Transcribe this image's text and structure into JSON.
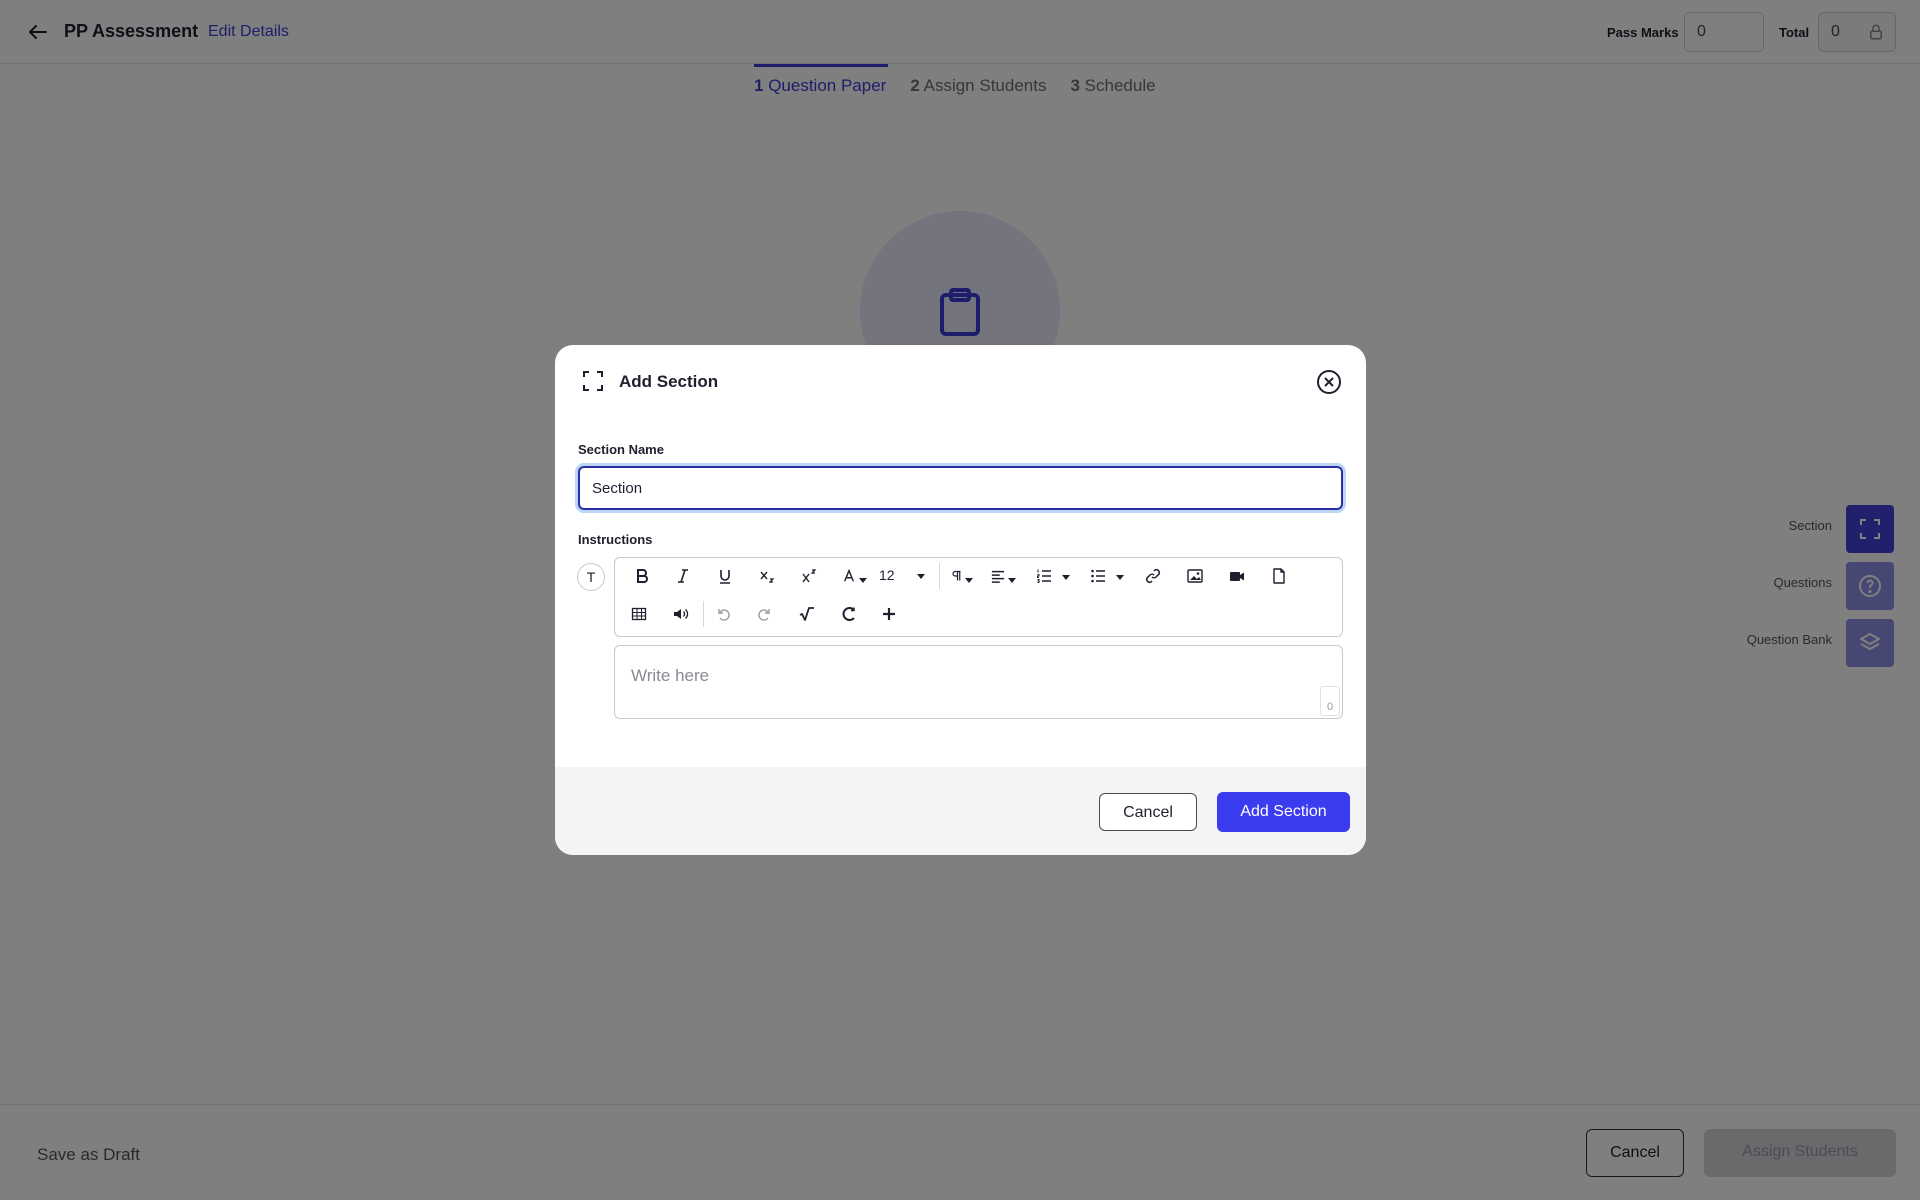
{
  "header": {
    "title": "PP Assessment",
    "edit_link": "Edit Details",
    "pass_marks_label": "Pass Marks",
    "pass_marks_value": "0",
    "total_label": "Total",
    "total_value": "0"
  },
  "steps": [
    {
      "num": "1",
      "label": "Question Paper",
      "active": true
    },
    {
      "num": "2",
      "label": "Assign Students",
      "active": false
    },
    {
      "num": "3",
      "label": "Schedule",
      "active": false
    }
  ],
  "side_tools": [
    {
      "label": "Section",
      "icon": "expand-icon"
    },
    {
      "label": "Questions",
      "icon": "question-circle-icon"
    },
    {
      "label": "Question Bank",
      "icon": "layers-icon"
    }
  ],
  "footer": {
    "save_draft": "Save as Draft",
    "cancel": "Cancel",
    "assign": "Assign Students"
  },
  "modal": {
    "title": "Add Section",
    "section_name_label": "Section Name",
    "section_name_value": "Section",
    "instructions_label": "Instructions",
    "t_toggle": "T",
    "font_size": "12",
    "editor_placeholder": "Write here",
    "char_count": "0",
    "cancel": "Cancel",
    "submit": "Add Section"
  },
  "colors": {
    "accent": "#3b3bf0",
    "tool_active": "#4141d9",
    "overlay": "rgba(0,0,0,0.5)"
  }
}
